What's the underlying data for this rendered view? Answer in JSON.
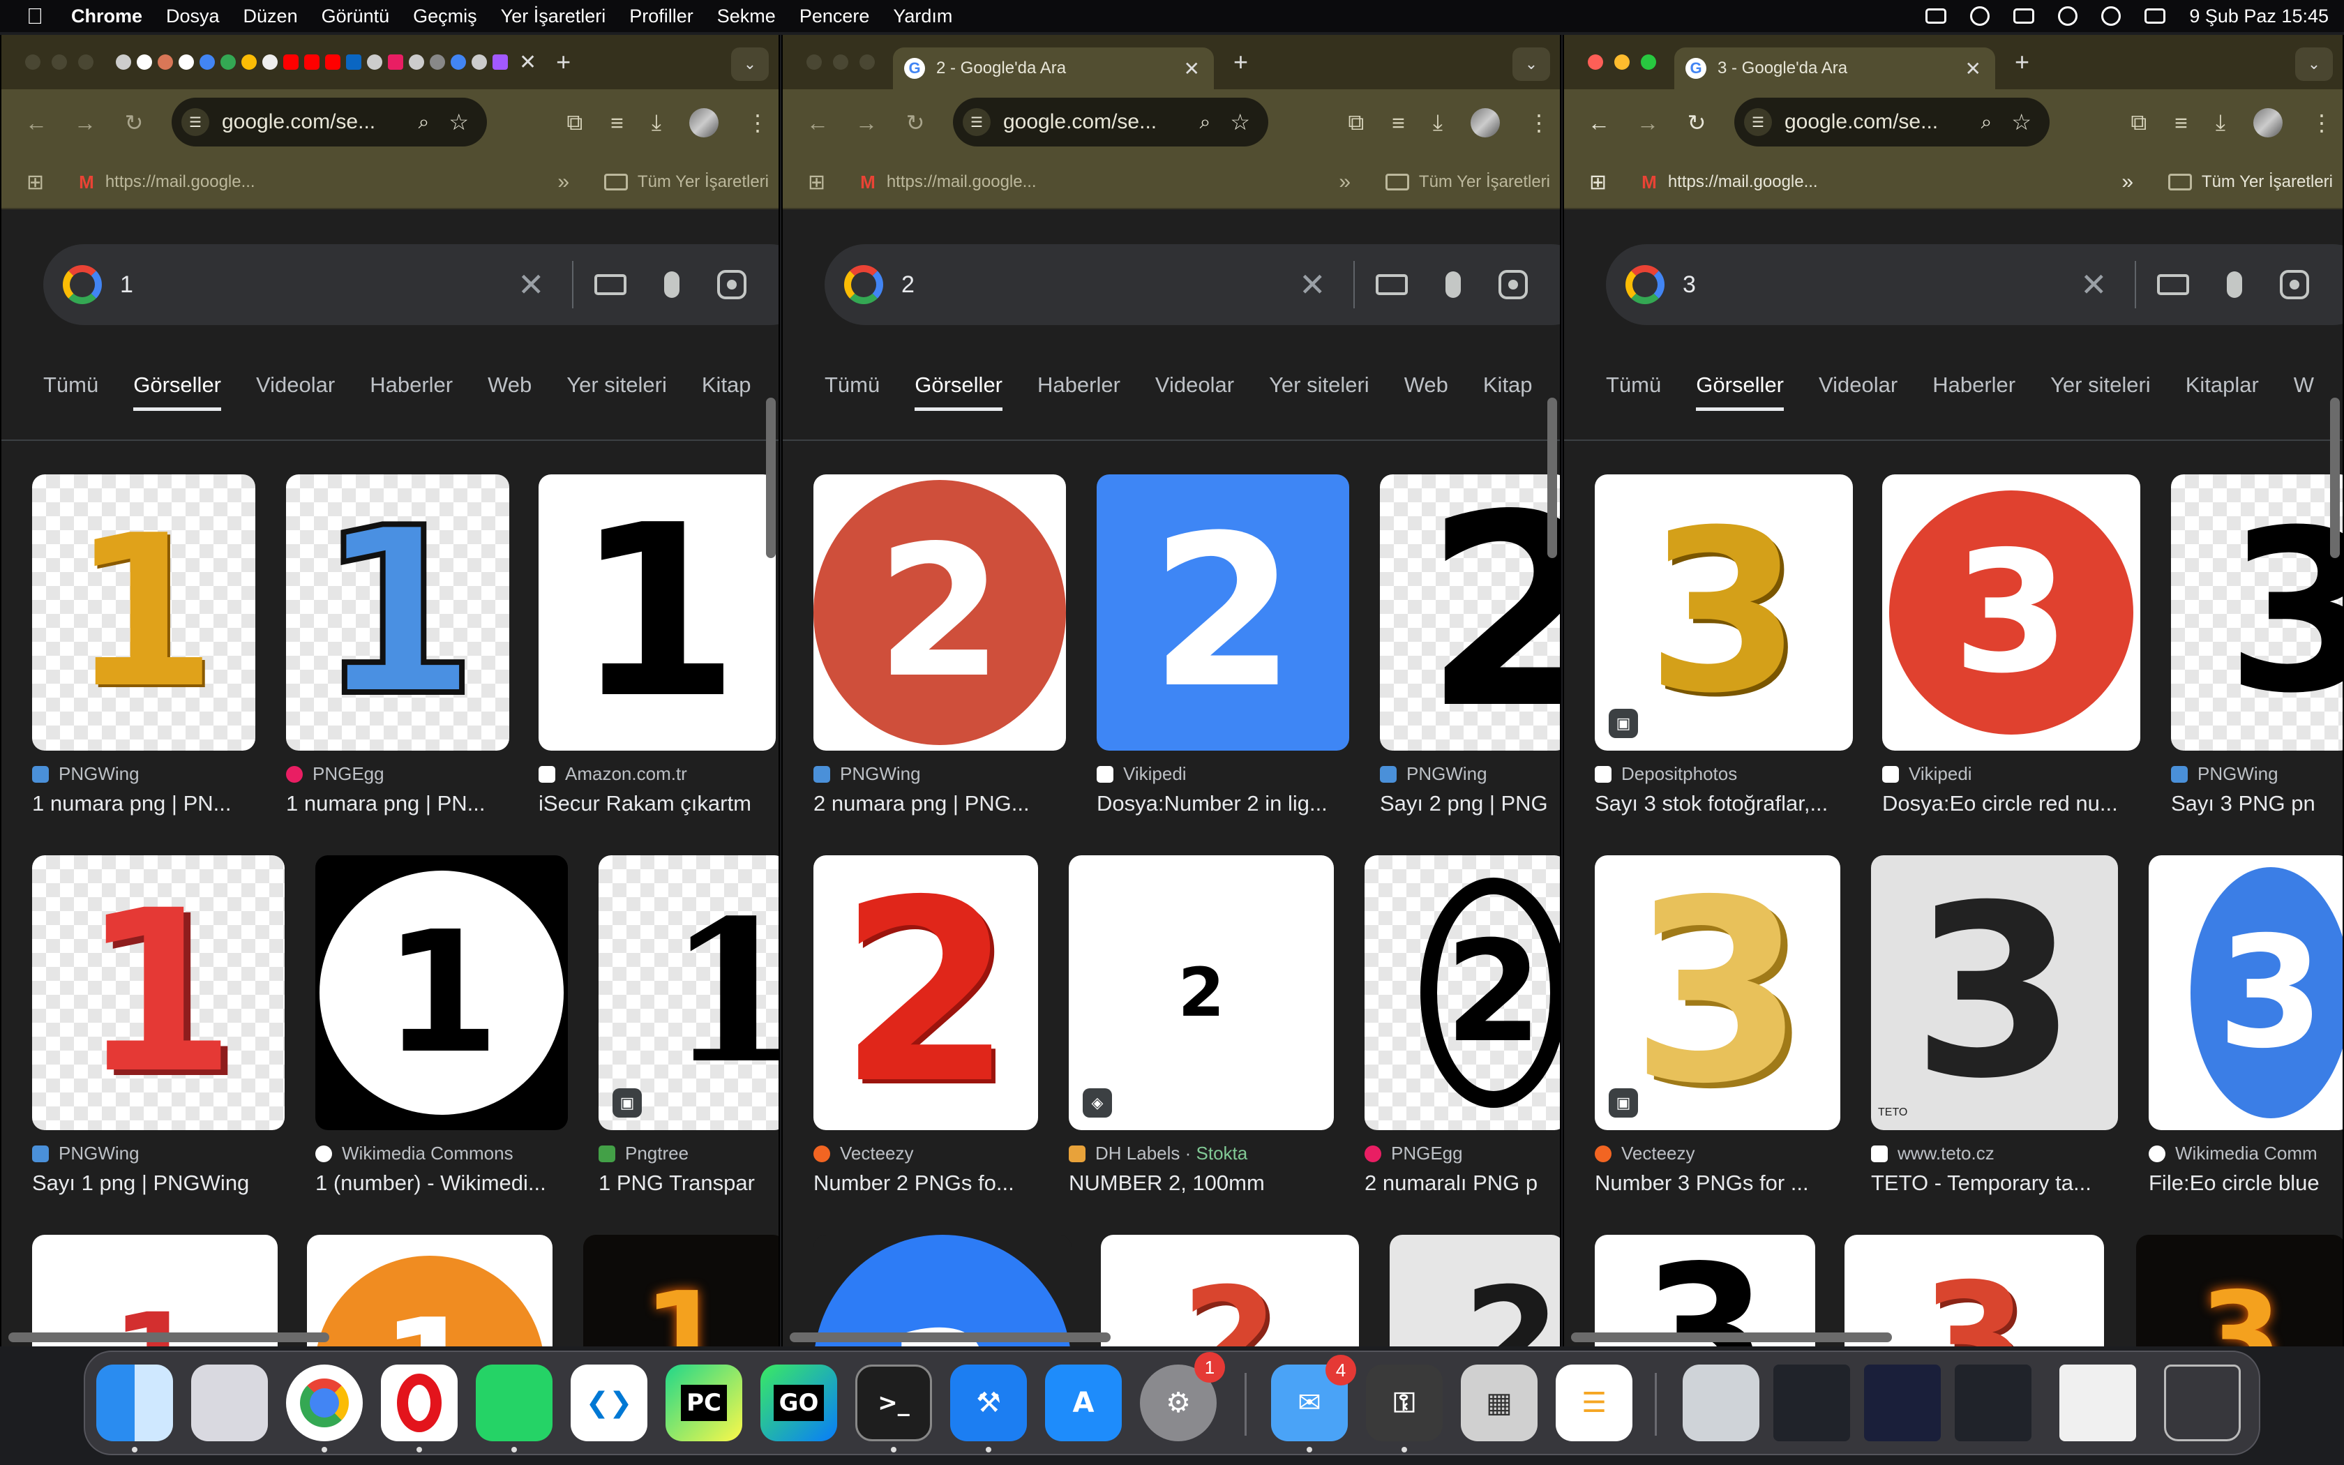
{
  "menubar": {
    "app": "Chrome",
    "items": [
      "Dosya",
      "Düzen",
      "Görüntü",
      "Geçmiş",
      "Yer İşaretleri",
      "Profiller",
      "Sekme",
      "Pencere",
      "Yardım"
    ],
    "clock": "9 Şub Paz  15:45"
  },
  "windows": [
    {
      "tab_title": "",
      "url": "google.com/se...",
      "bookmark_url": "https://mail.google...",
      "bookmark_folder": "Tüm Yer İşaretleri",
      "query": "1",
      "tabs": [
        "Tümü",
        "Görseller",
        "Videolar",
        "Haberler",
        "Web",
        "Yer siteleri",
        "Kitap"
      ],
      "results": [
        {
          "source": "PNGWing",
          "title": "1 numara png | PN..."
        },
        {
          "source": "PNGEgg",
          "title": "1 numara png | PN..."
        },
        {
          "source": "Amazon.com.tr",
          "title": "iSecur Rakam çıkartm"
        },
        {
          "source": "PNGWing",
          "title": "Sayı 1 png | PNGWing"
        },
        {
          "source": "Wikimedia Commons",
          "title": "1 (number) - Wikimedi..."
        },
        {
          "source": "Pngtree",
          "title": "1 PNG Transpar"
        }
      ]
    },
    {
      "tab_title": "2 - Google'da Ara",
      "url": "google.com/se...",
      "bookmark_url": "https://mail.google...",
      "bookmark_folder": "Tüm Yer İşaretleri",
      "query": "2",
      "tabs": [
        "Tümü",
        "Görseller",
        "Haberler",
        "Videolar",
        "Yer siteleri",
        "Web",
        "Kitap"
      ],
      "results": [
        {
          "source": "PNGWing",
          "title": "2 numara png | PNG..."
        },
        {
          "source": "Vikipedi",
          "title": "Dosya:Number 2 in lig..."
        },
        {
          "source": "PNGWing",
          "title": "Sayı 2 png | PNG"
        },
        {
          "source": "Vecteezy",
          "title": "Number 2 PNGs fo..."
        },
        {
          "source": "DH Labels",
          "stock": "Stokta",
          "title": "NUMBER 2, 100mm"
        },
        {
          "source": "PNGEgg",
          "title": "2 numaralı PNG p"
        }
      ]
    },
    {
      "tab_title": "3 - Google'da Ara",
      "url": "google.com/se...",
      "bookmark_url": "https://mail.google...",
      "bookmark_folder": "Tüm Yer İşaretleri",
      "query": "3",
      "tabs": [
        "Tümü",
        "Görseller",
        "Videolar",
        "Haberler",
        "Yer siteleri",
        "Kitaplar",
        "W"
      ],
      "results": [
        {
          "source": "Depositphotos",
          "title": "Sayı 3 stok fotoğraflar,..."
        },
        {
          "source": "Vikipedi",
          "title": "Dosya:Eo circle red nu..."
        },
        {
          "source": "PNGWing",
          "title": "Sayı 3 PNG pn"
        },
        {
          "source": "Vecteezy",
          "title": "Number 3 PNGs for ..."
        },
        {
          "source": "www.teto.cz",
          "title": "TETO - Temporary ta..."
        },
        {
          "source": "Wikimedia Comm",
          "title": "File:Eo circle blue"
        }
      ]
    }
  ],
  "image_digits": {
    "w1": "1",
    "w2": "2",
    "w3": "3"
  },
  "watermark": "TETO",
  "dock": {
    "badges": {
      "settings": "1",
      "mail": "4"
    },
    "icons": [
      "finder-icon",
      "launchpad-icon",
      "chrome-icon",
      "opera-icon",
      "whatsapp-icon",
      "vscode-icon",
      "pycharm-icon",
      "goland-icon",
      "terminal-icon",
      "xcode-icon",
      "appstore-icon",
      "system-settings-icon",
      "mail-icon",
      "keychain-icon",
      "calculator-icon",
      "reminders-icon",
      "preview-icon",
      "window-thumb-icon",
      "window-thumb-icon",
      "window-thumb-icon",
      "window-thumb-icon",
      "trash-icon"
    ],
    "labels": {
      "pycharm": "PC",
      "goland": "GO",
      "terminal": ">_"
    }
  },
  "colors": {
    "accent_red": "#ea4335",
    "accent_blue": "#4285f4",
    "chrome_frame": "#524e31"
  }
}
